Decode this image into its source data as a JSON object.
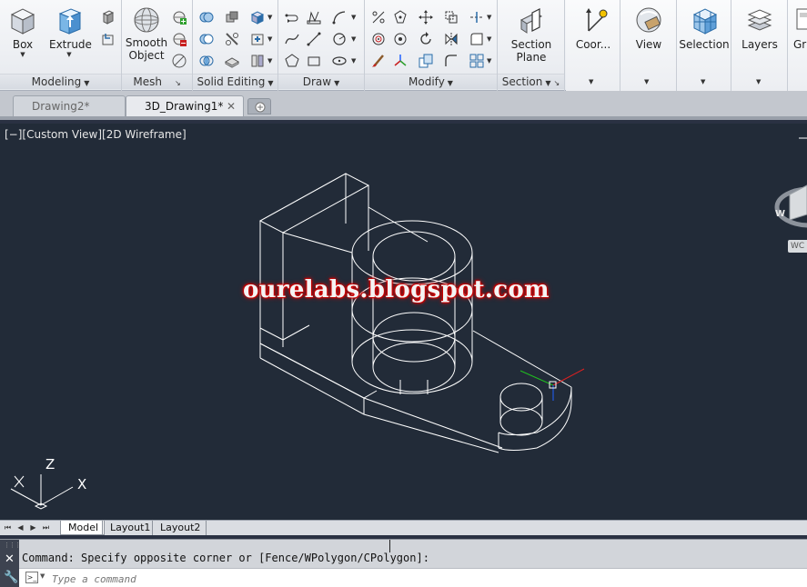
{
  "ribbon": {
    "modeling": {
      "title": "Modeling",
      "box_label": "Box",
      "extrude_label": "Extrude"
    },
    "mesh": {
      "title": "Mesh",
      "smooth_label": "Smooth",
      "object_label": "Object"
    },
    "solid_editing": {
      "title": "Solid Editing"
    },
    "draw": {
      "title": "Draw"
    },
    "modify": {
      "title": "Modify"
    },
    "section": {
      "title": "Section",
      "plane_label": "Section",
      "plane_label2": "Plane"
    },
    "coordinates": {
      "label": "Coor..."
    },
    "view": {
      "label": "View"
    },
    "selection": {
      "label": "Selection"
    },
    "layers": {
      "label": "Layers"
    },
    "groups": {
      "label": "Gr"
    }
  },
  "doc_tabs": [
    {
      "label": "Drawing2*",
      "active": false
    },
    {
      "label": "3D_Drawing1*",
      "active": true
    }
  ],
  "viewport": {
    "label": "[−][Custom View][2D Wireframe]",
    "watermark": "ourelabs.blogspot.com",
    "ucs": {
      "x": "X",
      "z": "Z"
    },
    "viewcube": {
      "w": "W",
      "wcs": "WC"
    }
  },
  "layout_tabs": [
    "Model",
    "Layout1",
    "Layout2"
  ],
  "command": {
    "output": "Command: Specify opposite corner or [Fence/WPolygon/CPolygon]:",
    "placeholder": "Type a command"
  },
  "colors": {
    "viewport_bg": "#222b38",
    "wire": "#ffffff",
    "ucs_x": "#e02020",
    "ucs_y": "#20c020",
    "ucs_z": "#2060ff"
  }
}
